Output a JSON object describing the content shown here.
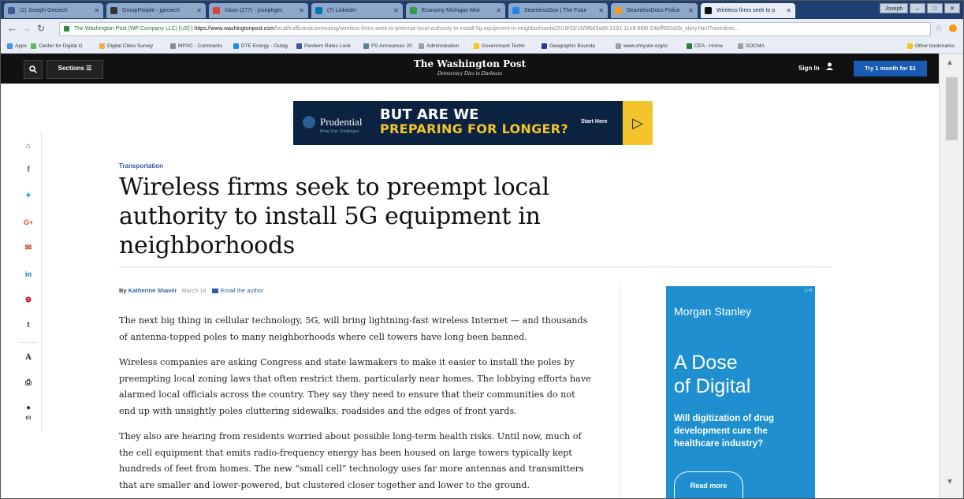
{
  "browser": {
    "tabs": [
      {
        "label": "(2) Joseph Geciech",
        "color": "#3b5998"
      },
      {
        "label": "GroupPeople - jgeciech",
        "color": "#333333"
      },
      {
        "label": "Inbox (277) - josephgec",
        "color": "#d44638"
      },
      {
        "label": "(7) LinkedIn",
        "color": "#0077b5"
      },
      {
        "label": "Economy Michigan Micr",
        "color": "#2e9e4a"
      },
      {
        "label": "SeamlessGov | The Futur",
        "color": "#1e88e5"
      },
      {
        "label": "SeamlessDocs Police",
        "color": "#f59b2a"
      },
      {
        "label": "Wireless firms seek to p",
        "color": "#111111"
      }
    ],
    "window_label": "Joseph",
    "address": {
      "site": "The Washington Post (WP Company LLC) [US]",
      "host": "https://www.washingtonpost.com",
      "path": "/local/trafficandcommuting/wireless-firms-seek-to-preempt-local-authority-to-install-5g-equipment-in-neighborhoods/2018/03/18/9f0d5a96-2191-11e8-86f6-54bfff693d2b_story.html?noredirec..."
    },
    "bookmarks": [
      {
        "label": "Apps",
        "color": "#4b8bf5"
      },
      {
        "label": "Center for Digital G",
        "color": "#5cb85c"
      },
      {
        "label": "Digital Cities Survey",
        "color": "#f0ad4e"
      },
      {
        "label": "MPSC - Comments",
        "color": "#888888"
      },
      {
        "label": "DTE Energy - Outag",
        "color": "#1e88e5"
      },
      {
        "label": "Perdiem Rates Look",
        "color": "#3a56a5"
      },
      {
        "label": "PS Announces 20",
        "color": "#607d8b"
      },
      {
        "label": "Administration",
        "color": "#9e9e9e"
      },
      {
        "label": "Government Techn",
        "color": "#f5c518"
      },
      {
        "label": "Geographic Bounda",
        "color": "#283593"
      },
      {
        "label": "www.chrysler.org/cr",
        "color": "#9e9e9e"
      },
      {
        "label": "CEA - Home",
        "color": "#2e7d32"
      },
      {
        "label": "SOCMA",
        "color": "#9e9e9e"
      },
      {
        "label": "Other bookmarks",
        "color": "#f5c518"
      }
    ]
  },
  "header": {
    "sections_label": "Sections",
    "masthead": "The Washington Post",
    "tagline": "Democracy Dies in Darkness",
    "signin_label": "Sign In",
    "subscribe_label": "Try 1 month for $1"
  },
  "ad_top": {
    "brand": "Prudential",
    "brand_sub": "Bring Your Challenges",
    "line1": "BUT ARE WE",
    "line2": "PREPARING FOR LONGER?",
    "cta": "Start Here"
  },
  "share_rail": {
    "icons": [
      "home-icon",
      "facebook-icon",
      "twitter-icon",
      "google-plus-icon",
      "email-icon",
      "linkedin-icon",
      "pinterest-icon",
      "tumblr-icon",
      "text-size-icon",
      "print-icon",
      "comments-icon"
    ],
    "comment_count": "63"
  },
  "article": {
    "kicker": "Transportation",
    "headline": "Wireless firms seek to preempt local authority to install 5G equipment in neighborhoods",
    "by": "By",
    "author": "Katherine Shaver",
    "date": "March 18",
    "email_author": "Email the author",
    "paragraphs": [
      "The next big thing in cellular technology, 5G, will bring lightning-fast wireless Internet — and thousands of antenna-topped poles to many neighborhoods where cell towers have long been banned.",
      "Wireless companies are asking Congress and state lawmakers to make it easier to install the poles by preempting local zoning laws that often restrict them, particularly near homes. The lobbying efforts have alarmed local officials across the country. They say they need to ensure that their communities do not end up with unsightly poles cluttering sidewalks, roadsides and the edges of front yards.",
      "They also are hearing from residents worried about possible long-term health risks. Until now, much of the cell equipment that emits radio-frequency energy has been housed on large towers typically kept hundreds of feet from homes. The new “small cell” technology uses far more antennas and transmitters that are smaller and lower-powered, but clustered closer together and lower to the ground."
    ]
  },
  "ad_side": {
    "brand": "Morgan Stanley",
    "headline_1": "A Dose",
    "headline_2": "of Digital",
    "question": "Will digitization of drug development cure the healthcare industry?",
    "cta": "Read more"
  },
  "colors": {
    "brand_blue": "#1a5cb3",
    "link_blue": "#2a5ea7",
    "ad_navy": "#0b2240",
    "ad_yellow": "#f3c52a",
    "side_ad_blue": "#1f8fcf"
  }
}
